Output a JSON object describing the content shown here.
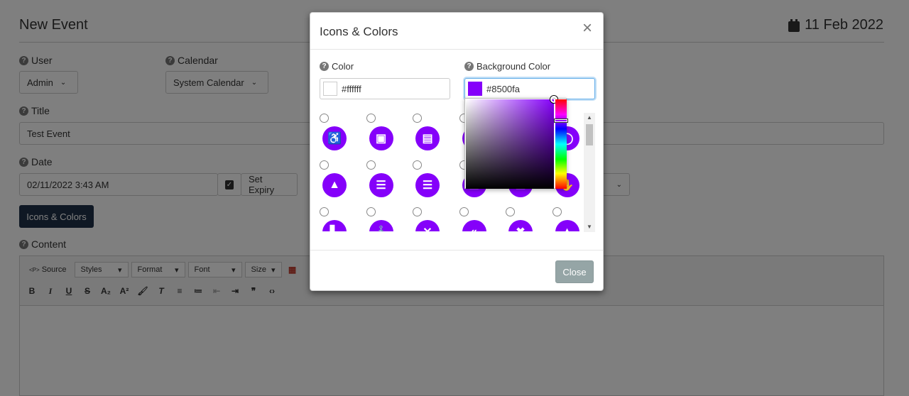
{
  "page": {
    "title": "New Event",
    "date": "11 Feb 2022",
    "fields": {
      "user_label": "User",
      "user_value": "Admin",
      "calendar_label": "Calendar",
      "calendar_value": "System Calendar",
      "title_label": "Title",
      "title_value": "Test Event",
      "date_label": "Date",
      "date_value": "02/11/2022 3:43 AM",
      "set_expiry": "Set Expiry",
      "icons_colors_button": "Icons & Colors",
      "content_label": "Content"
    },
    "editor_toolbar": {
      "source": "Source",
      "styles": "Styles",
      "format": "Format",
      "font": "Font",
      "size": "Size"
    }
  },
  "modal": {
    "title": "Icons & Colors",
    "color_label": "Color",
    "color_value": "#ffffff",
    "bg_color_label": "Background Color",
    "bg_color_value": "#8500fa",
    "close_button": "Close",
    "accent": "#8500fa",
    "icons": [
      [
        "wheelchair-icon",
        "address-book-icon",
        "id-card-icon",
        "hidden-icon",
        "hidden-icon",
        "circle-o-icon"
      ],
      [
        "tree-icon",
        "align-center-icon",
        "align-justify-icon",
        "align-left-icon",
        "align-right-icon",
        "hand-icon"
      ],
      [
        "ambulance-icon",
        "anchor-icon",
        "times-icon",
        "backward-icon",
        "close-icon",
        "up-icon"
      ]
    ]
  }
}
